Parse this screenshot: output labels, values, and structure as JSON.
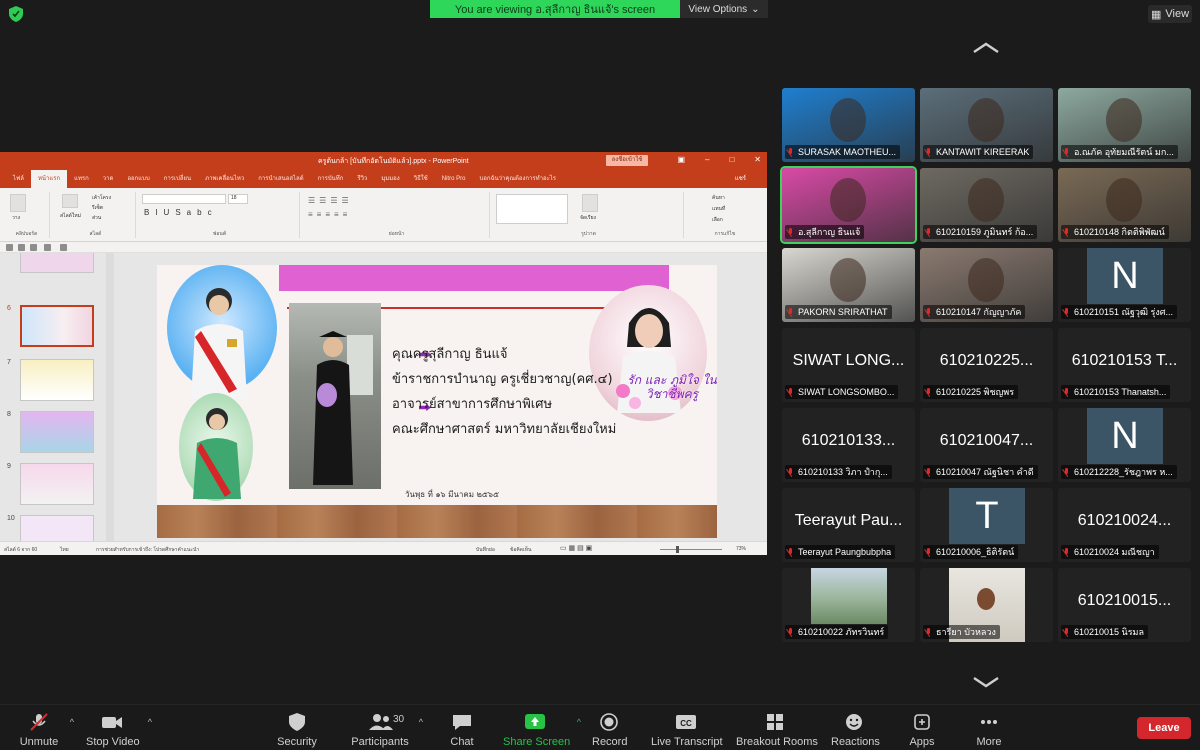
{
  "top": {
    "banner_text": "You are viewing อ.สุลีกาญ ธินแจ้'s screen",
    "view_options": "View Options",
    "view_button": "View"
  },
  "ppt": {
    "title": "ครูต้นกล้า [บันทึกอัตโนมัติแล้ว].pptx - PowerPoint",
    "signin": "ลงชื่อเข้าใช้",
    "tabs": [
      "ไฟล์",
      "หน้าแรก",
      "แทรก",
      "วาด",
      "ออกแบบ",
      "การเปลี่ยน",
      "ภาพเคลื่อนไหว",
      "การนำเสนอสไลด์",
      "การบันทึก",
      "รีวิว",
      "มุมมอง",
      "วิธีใช้",
      "Nitro Pro",
      "บอกฉันว่าคุณต้องการทำอะไร"
    ],
    "share": "แชร์",
    "groups": [
      "คลิปบอร์ด",
      "สไลด์",
      "ฟอนต์",
      "ย่อหน้า",
      "รูปวาด",
      "การแก้ไข"
    ],
    "font_size": "18",
    "ribbon_labels": [
      "วาง",
      "สไลด์ใหม่",
      "เค้าโครง",
      "รีเซ็ต",
      "ส่วน",
      "จัดเรียง",
      "ค้นหา",
      "แทนที่",
      "เลือก"
    ],
    "slide_numbers": [
      "6",
      "7",
      "8",
      "9",
      "10"
    ],
    "status": {
      "slide_count": "สไลด์ 6 จาก 60",
      "lang": "ไทย",
      "accessibility": "การช่วยสำหรับการเข้าถึง: โปรดศึกษาคำแนะนำ",
      "notes": "บันทึกย่อ",
      "comments": "ข้อคิดเห็น",
      "zoom": "73%"
    }
  },
  "slide": {
    "lines": [
      "คุณครูสุลีกาญ ธินแจ้",
      "ข้าราชการบำนาญ ครูเชี่ยวชาญ(คศ.๔)",
      "อาจารย์สาขาการศึกษาพิเศษ",
      "คณะศึกษาศาสตร์ มหาวิทยาลัยเชียงใหม่"
    ],
    "date": "วันพุธ ที่ ๑๖ มีนาคม ๒๕๖๕",
    "slogan": "รัก และ ภูมิใจ ในวิชาชีพครู"
  },
  "gallery": [
    {
      "name": "SURASAK MAOTHEU...",
      "big": "",
      "type": "video",
      "bg": "#1f7fd0"
    },
    {
      "name": "KANTAWIT KIREERAK",
      "big": "",
      "type": "video",
      "bg": "#5b6e7a"
    },
    {
      "name": "อ.ณภัค อุทัยมณีรัตน์ มก...",
      "big": "",
      "type": "video",
      "bg": "#8da9a0"
    },
    {
      "name": "อ.สุลีกาญ ธินแจ้",
      "big": "",
      "type": "video",
      "bg": "#d94aa6",
      "active": true
    },
    {
      "name": "610210159 ภูมินทร์ ก้อ...",
      "big": "",
      "type": "video",
      "bg": "#6e6a62"
    },
    {
      "name": "610210148 กิตติพิพัฒน์",
      "big": "",
      "type": "video",
      "bg": "#7a6a55"
    },
    {
      "name": "PAKORN SRIRATHAT",
      "big": "",
      "type": "video",
      "bg": "#d8d7d0"
    },
    {
      "name": "610210147 กัญญาภัค",
      "big": "",
      "type": "video",
      "bg": "#8a7a70"
    },
    {
      "name": "610210151 ณัฐวุฒิ รุ่งศ...",
      "big": "N",
      "type": "avatar",
      "bg": "#3b5566"
    },
    {
      "name": "SIWAT LONGSOMBO...",
      "big": "SIWAT LONG...",
      "type": "text",
      "bg": ""
    },
    {
      "name": "610210225 พิชญพร",
      "big": "610210225...",
      "type": "text",
      "bg": ""
    },
    {
      "name": "610210153 Thanatsh...",
      "big": "610210153 T...",
      "type": "text",
      "bg": ""
    },
    {
      "name": "610210133 วิภา ปำกุ...",
      "big": "610210133...",
      "type": "text",
      "bg": ""
    },
    {
      "name": "610210047 ณัฐนิชา คำดี",
      "big": "610210047...",
      "type": "text",
      "bg": ""
    },
    {
      "name": "610212228_รัชฎาพร ห...",
      "big": "N",
      "type": "avatar",
      "bg": "#3b5566"
    },
    {
      "name": "Teerayut Paungbubpha",
      "big": "Teerayut Pau...",
      "type": "text",
      "bg": ""
    },
    {
      "name": "610210006_ธิติรัตน์",
      "big": "T",
      "type": "avatar",
      "bg": "#3b5566"
    },
    {
      "name": "610210024 มณีชญา",
      "big": "610210024...",
      "type": "text",
      "bg": ""
    },
    {
      "name": "610210022 ภัทรวินทร์",
      "big": "",
      "type": "photo",
      "bg": "#7a9a7a"
    },
    {
      "name": "ธารียา บัวหลวง",
      "big": "",
      "type": "video2",
      "bg": "#d6d4cf"
    },
    {
      "name": "610210015 นิรมล",
      "big": "610210015...",
      "type": "text",
      "bg": ""
    }
  ],
  "toolbar": {
    "unmute": "Unmute",
    "stop_video": "Stop Video",
    "security": "Security",
    "participants": "Participants",
    "participant_count": "30",
    "chat": "Chat",
    "share_screen": "Share Screen",
    "record": "Record",
    "live_transcript": "Live Transcript",
    "breakout_rooms": "Breakout Rooms",
    "reactions": "Reactions",
    "apps": "Apps",
    "more": "More",
    "leave": "Leave"
  },
  "colors": {
    "accent_green": "#2ed65a",
    "ppt_red": "#c43e1c",
    "leave_red": "#d4262d"
  }
}
